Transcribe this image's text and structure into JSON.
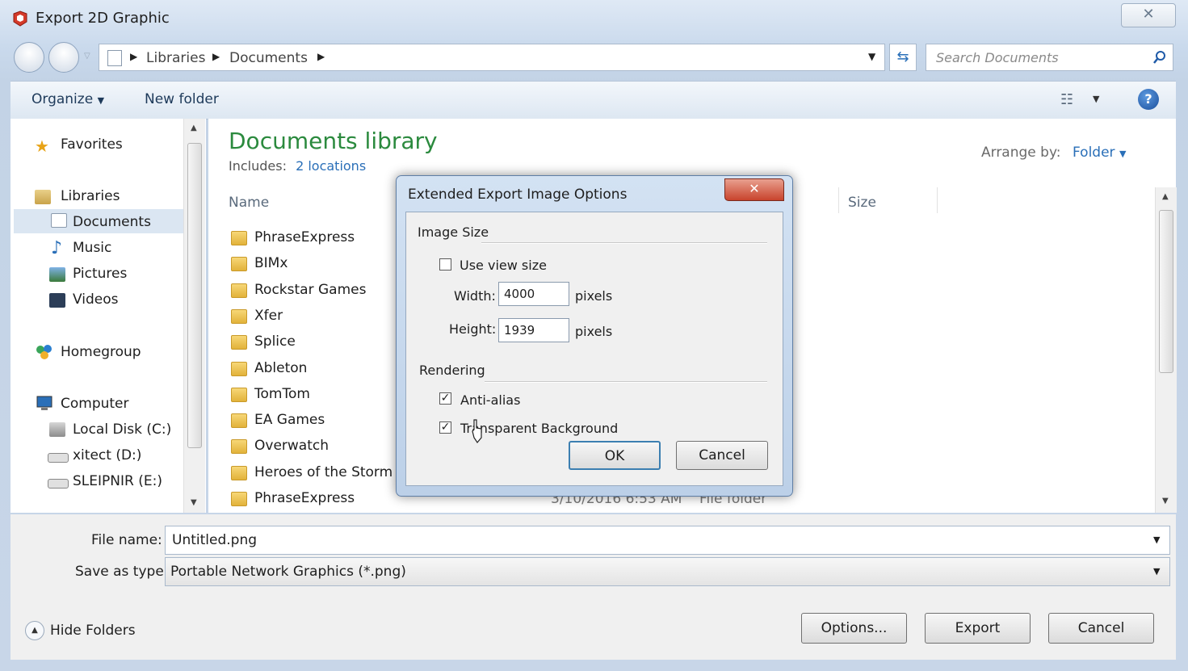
{
  "window": {
    "title": "Export 2D Graphic",
    "close_glyph": "✕"
  },
  "nav": {
    "breadcrumb": [
      "Libraries",
      "Documents"
    ],
    "search_placeholder": "Search Documents"
  },
  "toolbar": {
    "organize": "Organize",
    "new_folder": "New folder"
  },
  "sidebar": {
    "favorites": "Favorites",
    "libraries": "Libraries",
    "library_items": [
      "Documents",
      "Music",
      "Pictures",
      "Videos"
    ],
    "homegroup": "Homegroup",
    "computer": "Computer",
    "drives": [
      "Local Disk (C:)",
      "xitect (D:)",
      "SLEIPNIR (E:)"
    ]
  },
  "library": {
    "title": "Documents library",
    "includes_label": "Includes:",
    "includes_link": "2 locations",
    "arrange_label": "Arrange by:",
    "arrange_value": "Folder"
  },
  "columns": {
    "name": "Name",
    "size": "Size"
  },
  "folders": [
    "PhraseExpress",
    "BIMx",
    "Rockstar Games",
    "Xfer",
    "Splice",
    "Ableton",
    "TomTom",
    "EA Games",
    "Overwatch",
    "Heroes of the Storm",
    "PhraseExpress"
  ],
  "last_row": {
    "date": "3/10/2016 6:53 AM",
    "type": "File folder"
  },
  "bottom": {
    "file_name_label": "File name:",
    "file_name": "Untitled.png",
    "save_type_label": "Save as type:",
    "save_type": "Portable Network Graphics (*.png)",
    "hide_folders": "Hide Folders",
    "options": "Options...",
    "export": "Export",
    "cancel": "Cancel"
  },
  "dialog": {
    "title": "Extended Export Image Options",
    "image_size": "Image Size",
    "use_view_size": "Use view size",
    "use_view_size_checked": false,
    "width_label": "Width:",
    "width": "4000",
    "height_label": "Height:",
    "height": "1939",
    "pixels": "pixels",
    "rendering": "Rendering",
    "anti_alias": "Anti-alias",
    "anti_alias_checked": true,
    "transparent_bg": "Transparent Background",
    "transparent_bg_checked": true,
    "ok": "OK",
    "cancel": "Cancel",
    "check_glyph": "✓"
  },
  "colors": {
    "library_title": "#2b8a3e",
    "link": "#2a6fb8",
    "accent": "#1e5aa8"
  }
}
